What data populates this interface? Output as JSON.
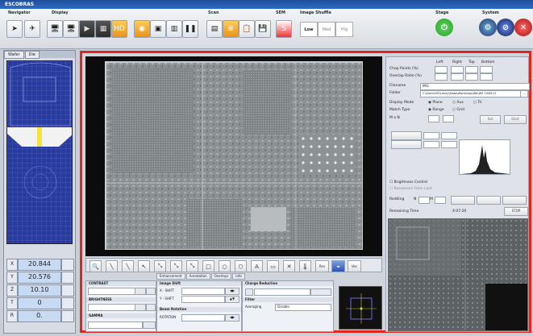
{
  "app": {
    "title": "ESCOBRAS"
  },
  "toolbar": {
    "groups": [
      "Navigator",
      "Display",
      "Scan",
      "SEM",
      "Image Shuffle",
      "Stage",
      "System"
    ],
    "shuffle_buttons": [
      "Low",
      "Med",
      "Hig"
    ]
  },
  "left": {
    "tabs": [
      "Wafer",
      "Die"
    ],
    "coords": [
      {
        "label": "X",
        "value": "20.844"
      },
      {
        "label": "Y",
        "value": "20.576"
      },
      {
        "label": "Z",
        "value": "10.10"
      },
      {
        "label": "T",
        "value": "0"
      },
      {
        "label": "R",
        "value": "0."
      }
    ]
  },
  "tools": [
    "🔍",
    "╲",
    "╲",
    "↖",
    "⤡",
    "⤡",
    "⤡",
    "□",
    "○",
    "⬡",
    "A",
    "▭",
    "✕",
    "🌡",
    "Res",
    "▬",
    "Vec"
  ],
  "bottom": {
    "tabs": [
      "Enhancement",
      "Annotation",
      "Overlays",
      "Info"
    ],
    "contrast": "CONTRAST",
    "brightness": "BRIGHTNESS",
    "gamma": "GAMMA",
    "image_shift": "Image Shift",
    "shift_x": "X - SHIFT",
    "shift_y": "Y - SHIFT",
    "beam_rotation": "Beam Rotation",
    "rotation": "ROTATION",
    "charge_reduction": "Charge Reduction",
    "filter": "Filter",
    "averaging": "Averaging",
    "averaging_value": "Disable"
  },
  "right": {
    "chop_points": "Chop Points (%)",
    "overlap_ratio": "Overlap Ratio (%)",
    "col_left": "Left",
    "col_right": "Right",
    "col_top": "Top",
    "col_bottom": "Bottom",
    "filename_label": "Filename",
    "filename": "IMG",
    "folder_label": "Folder",
    "folder": "C:\\Users\\SE\\Lavey\\Data\\Workshop\\Wb\\WS 10\\6121",
    "display_mode": "Display Mode",
    "mode_options": [
      "Plane",
      "Aux",
      "Tri"
    ],
    "match_type": "Match Type",
    "match_options": [
      "Range",
      "Grid"
    ],
    "m_n": "M x N",
    "set_label": "Set",
    "start_label": "Start",
    "brightness_control": "Brightness Control",
    "reconnect": "Reconnect From Last",
    "redding": "Redding",
    "redding_n": "N",
    "redding_m": "M",
    "remaining_time": "Remaining Time",
    "remaining_value": "4:07:20",
    "stop_label": "STOP"
  }
}
